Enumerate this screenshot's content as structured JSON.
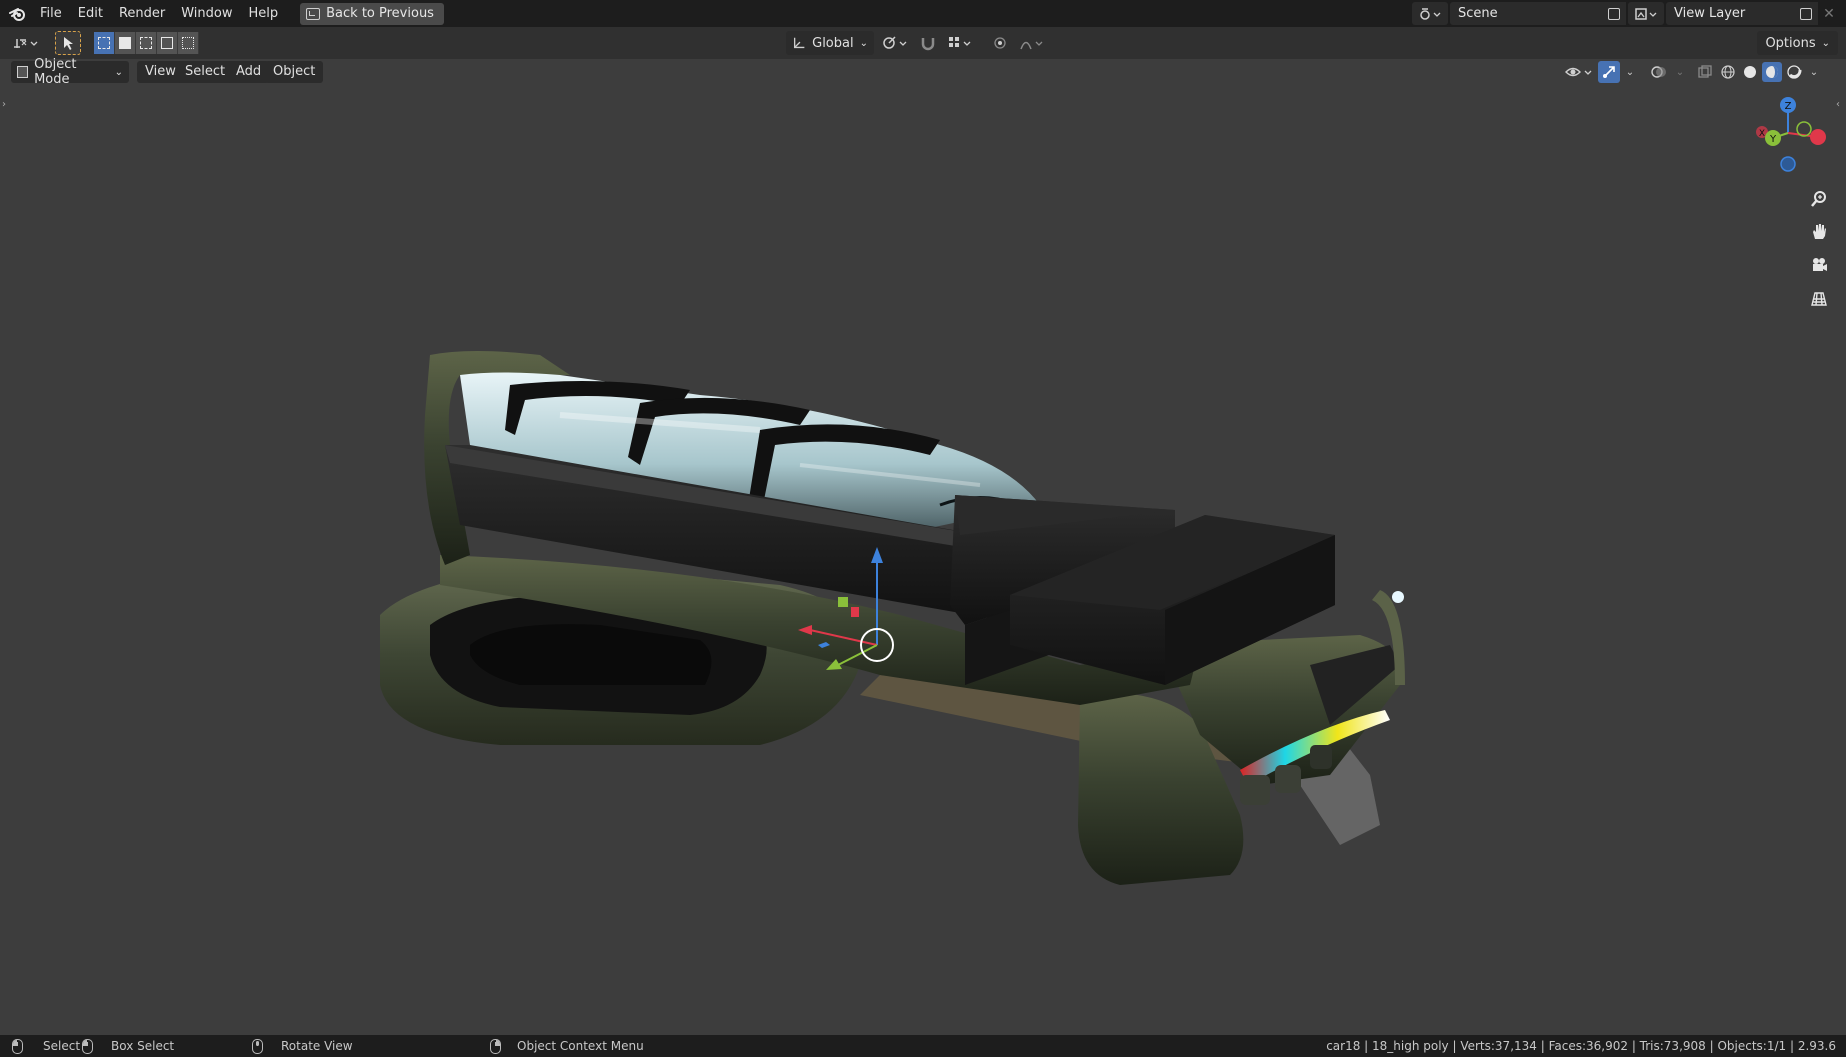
{
  "menubar": {
    "items": [
      "File",
      "Edit",
      "Render",
      "Window",
      "Help"
    ],
    "back_button": "Back to Previous"
  },
  "scene": {
    "label": "Scene"
  },
  "view_layer": {
    "label": "View Layer"
  },
  "toolbar": {
    "transform_orientation": "Global",
    "options_label": "Options"
  },
  "viewport_header": {
    "mode": "Object Mode",
    "menus": [
      "View",
      "Select",
      "Add",
      "Object"
    ]
  },
  "gizmo": {
    "x": "X",
    "y": "Y",
    "z": "Z"
  },
  "statusbar": {
    "select": "Select",
    "box_select": "Box Select",
    "rotate_view": "Rotate View",
    "context_menu": "Object Context Menu",
    "stats": "car18 | 18_high poly | Verts:37,134 | Faces:36,902 | Tris:73,908 | Objects:1/1 | 2.93.6"
  },
  "colors": {
    "accent": "#4772b3",
    "viewport_bg": "#3d3d3d",
    "axis_x": "#e0384a",
    "axis_y": "#8ac03a",
    "axis_z": "#3d82dc"
  },
  "icons": {
    "logo": "blender-logo-icon",
    "zoom": "zoom-icon",
    "pan": "hand-icon",
    "camera": "camera-icon",
    "grid": "grid-view-icon"
  }
}
